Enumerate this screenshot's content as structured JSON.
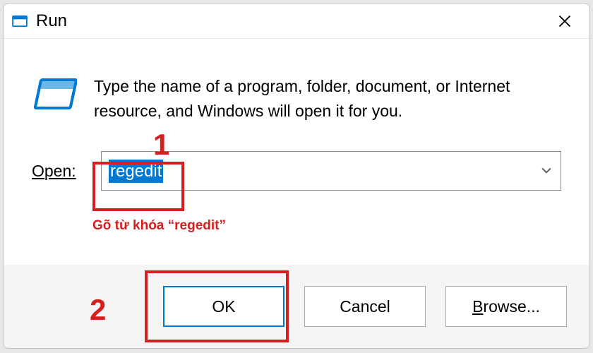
{
  "titlebar": {
    "title": "Run",
    "close_label": "Close"
  },
  "body": {
    "description": "Type the name of a program, folder, document, or Internet resource, and Windows will open it for you.",
    "open_label": "Open:",
    "input_value": "regedit"
  },
  "buttons": {
    "ok": "OK",
    "cancel": "Cancel",
    "browse": "Browse..."
  },
  "annotations": {
    "step1": "1",
    "step2": "2",
    "hint": "Gõ từ khóa “regedit”"
  },
  "colors": {
    "accent": "#0078d4",
    "annotation": "#d62020"
  }
}
